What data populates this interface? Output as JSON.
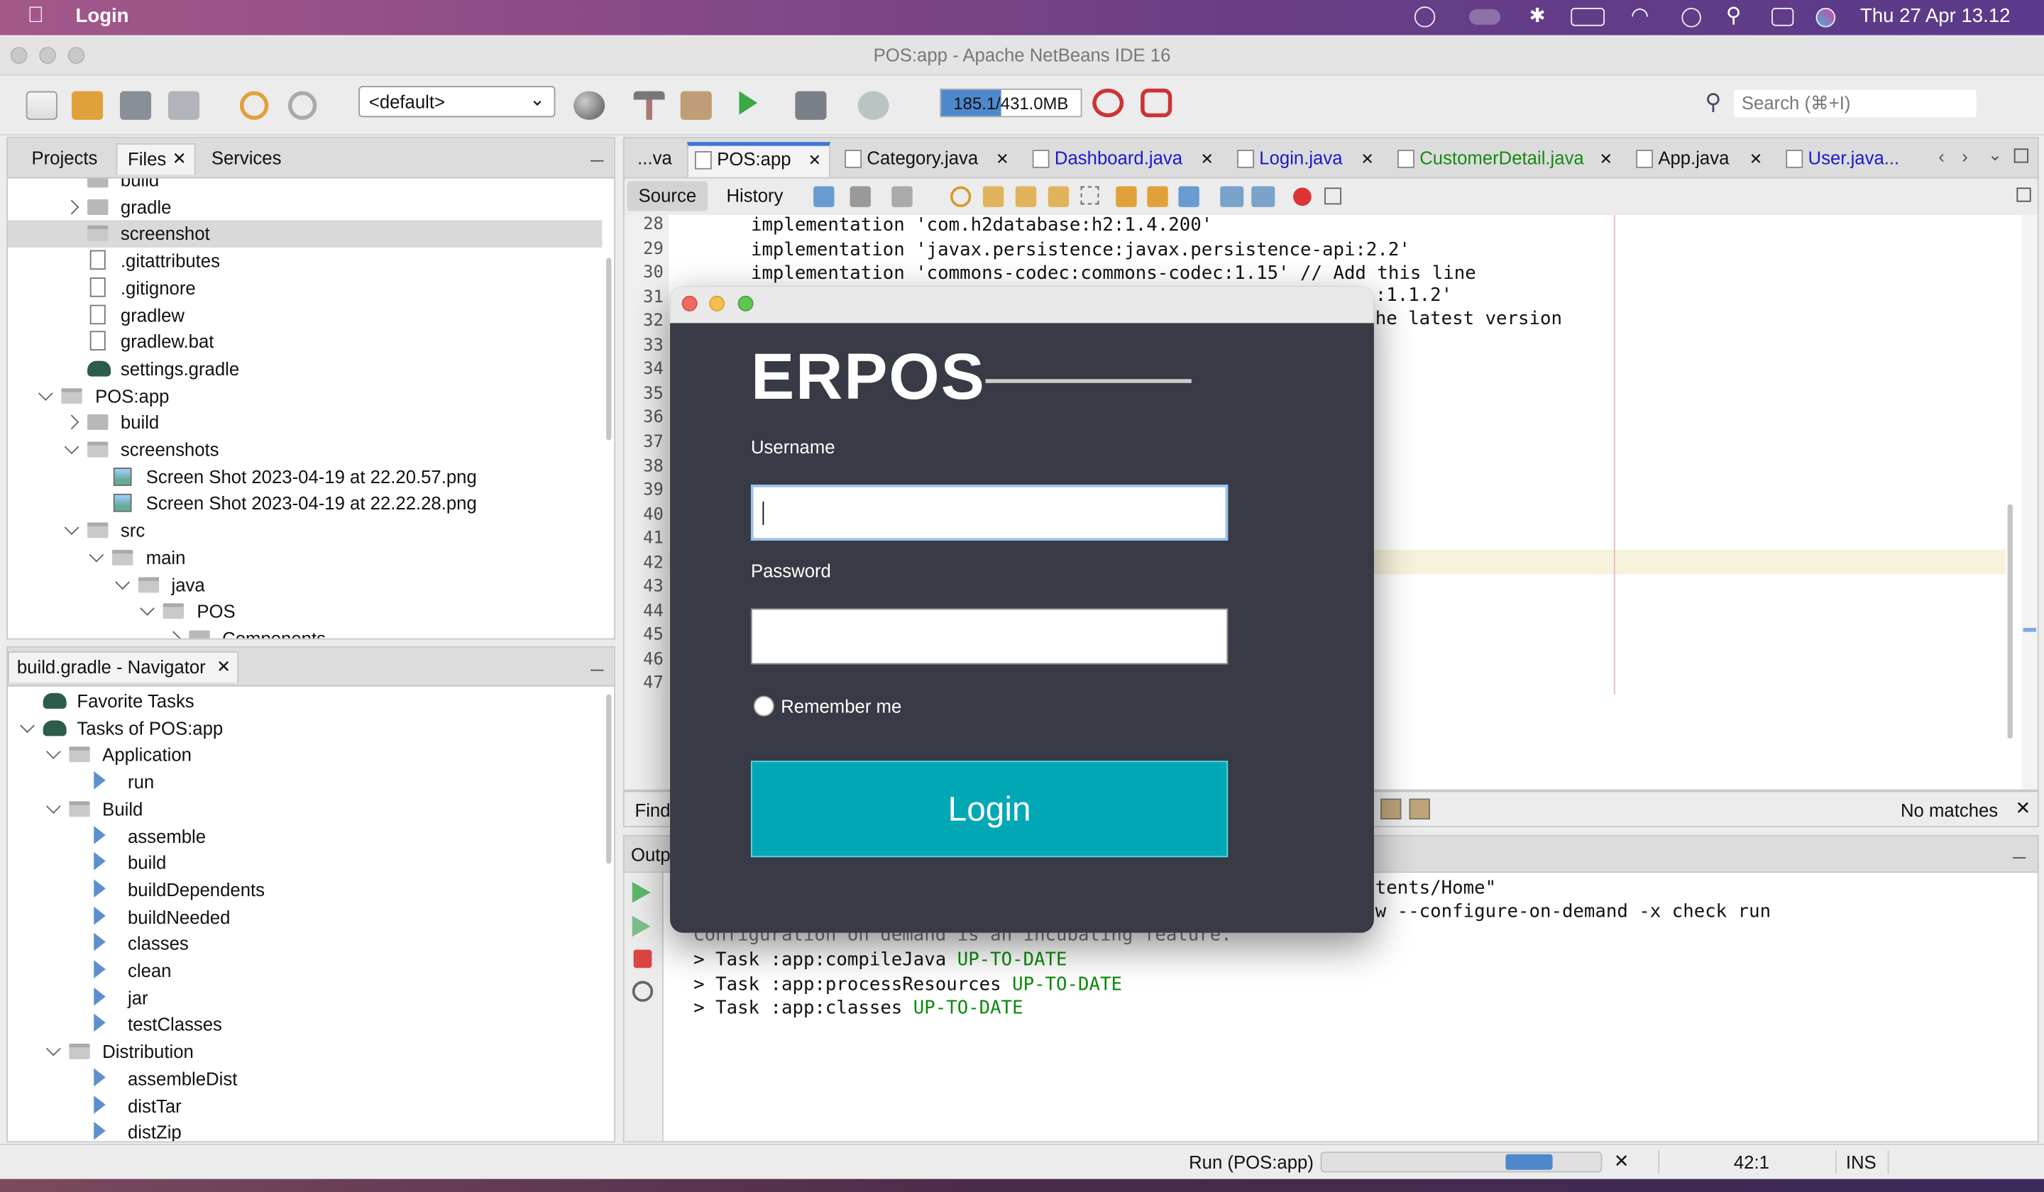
{
  "menubar": {
    "app": "Login",
    "datetime": "Thu 27 Apr  13.12"
  },
  "window": {
    "title": "POS:app - Apache NetBeans IDE 16"
  },
  "toolbar": {
    "config": "<default>",
    "memory": "185.1/431.0MB",
    "memory_fraction": 0.43,
    "search_placeholder": "Search (⌘+I)"
  },
  "left_tabs": [
    "Projects",
    "Files",
    "Services"
  ],
  "files_tree": [
    {
      "label": "build",
      "indent": 1,
      "kind": "folder",
      "arrow": "none"
    },
    {
      "label": "gradle",
      "indent": 1,
      "kind": "folder",
      "arrow": "right"
    },
    {
      "label": "screenshot",
      "indent": 1,
      "kind": "folder-open",
      "arrow": "none",
      "selected": true
    },
    {
      "label": ".gitattributes",
      "indent": 1,
      "kind": "file"
    },
    {
      "label": ".gitignore",
      "indent": 1,
      "kind": "file"
    },
    {
      "label": "gradlew",
      "indent": 1,
      "kind": "file"
    },
    {
      "label": "gradlew.bat",
      "indent": 1,
      "kind": "file"
    },
    {
      "label": "settings.gradle",
      "indent": 1,
      "kind": "gradle"
    },
    {
      "label": "POS:app",
      "indent": 0,
      "kind": "folder-open",
      "arrow": "down"
    },
    {
      "label": "build",
      "indent": 1,
      "kind": "folder",
      "arrow": "right"
    },
    {
      "label": "screenshots",
      "indent": 1,
      "kind": "folder-open",
      "arrow": "down"
    },
    {
      "label": "Screen Shot 2023-04-19 at 22.20.57.png",
      "indent": 2,
      "kind": "image"
    },
    {
      "label": "Screen Shot 2023-04-19 at 22.22.28.png",
      "indent": 2,
      "kind": "image"
    },
    {
      "label": "src",
      "indent": 1,
      "kind": "folder-open",
      "arrow": "down"
    },
    {
      "label": "main",
      "indent": 2,
      "kind": "folder-open",
      "arrow": "down"
    },
    {
      "label": "java",
      "indent": 3,
      "kind": "folder-open",
      "arrow": "down"
    },
    {
      "label": "POS",
      "indent": 4,
      "kind": "folder-open",
      "arrow": "down"
    },
    {
      "label": "Components",
      "indent": 5,
      "kind": "folder",
      "arrow": "right"
    }
  ],
  "navigator": {
    "title": "build.gradle - Navigator",
    "items": [
      {
        "label": "Favorite Tasks",
        "indent": 0,
        "kind": "gradle",
        "arrow": "none"
      },
      {
        "label": "Tasks of POS:app",
        "indent": 0,
        "kind": "gradle",
        "arrow": "down"
      },
      {
        "label": "Application",
        "indent": 1,
        "kind": "folder-open",
        "arrow": "down"
      },
      {
        "label": "run",
        "indent": 2,
        "kind": "task"
      },
      {
        "label": "Build",
        "indent": 1,
        "kind": "folder-open",
        "arrow": "down"
      },
      {
        "label": "assemble",
        "indent": 2,
        "kind": "task"
      },
      {
        "label": "build",
        "indent": 2,
        "kind": "task"
      },
      {
        "label": "buildDependents",
        "indent": 2,
        "kind": "task"
      },
      {
        "label": "buildNeeded",
        "indent": 2,
        "kind": "task"
      },
      {
        "label": "classes",
        "indent": 2,
        "kind": "task"
      },
      {
        "label": "clean",
        "indent": 2,
        "kind": "task"
      },
      {
        "label": "jar",
        "indent": 2,
        "kind": "task"
      },
      {
        "label": "testClasses",
        "indent": 2,
        "kind": "task"
      },
      {
        "label": "Distribution",
        "indent": 1,
        "kind": "folder-open",
        "arrow": "down"
      },
      {
        "label": "assembleDist",
        "indent": 2,
        "kind": "task"
      },
      {
        "label": "distTar",
        "indent": 2,
        "kind": "task"
      },
      {
        "label": "distZip",
        "indent": 2,
        "kind": "task"
      }
    ]
  },
  "editor_tabs": [
    {
      "label": "...va",
      "color": "#111111"
    },
    {
      "label": "POS:app",
      "color": "#111111",
      "active": true
    },
    {
      "label": "Category.java",
      "color": "#111111"
    },
    {
      "label": "Dashboard.java",
      "color": "#1a1ad0"
    },
    {
      "label": "Login.java",
      "color": "#1a1ad0"
    },
    {
      "label": "CustomerDetail.java",
      "color": "#138a13"
    },
    {
      "label": "App.java",
      "color": "#111111"
    },
    {
      "label": "User.java...",
      "color": "#1a1ad0"
    }
  ],
  "editor_subtabs": {
    "source": "Source",
    "history": "History"
  },
  "code": {
    "line_numbers": [
      "28",
      "29",
      "30",
      "31",
      "32",
      "33",
      "34",
      "35",
      "36",
      "37",
      "38",
      "39",
      "40",
      "41",
      "42",
      "43",
      "44",
      "45",
      "46",
      "47"
    ],
    "lines": [
      "    implementation 'com.h2database:h2:1.4.200'",
      "    implementation 'javax.persistence:javax.persistence-api:2.2'",
      "    implementation 'commons-codec:commons-codec:1.15' // Add this line"
    ],
    "partial_31": ":1.1.2'",
    "partial_32": "he latest version"
  },
  "login_dialog": {
    "brand": "ERPOS",
    "username_label": "Username",
    "username_value": "",
    "password_label": "Password",
    "remember": "Remember me",
    "login_button": "Login"
  },
  "find": {
    "label": "Find",
    "no_matches": "No matches"
  },
  "output": {
    "label": "Outp",
    "partial_1": "tents/Home\"",
    "partial_2": "w --configure-on-demand -x check run",
    "partial_3": "Configuration on demand is an incubating feature.",
    "tasks": [
      {
        "task": "> Task :app:compileJava ",
        "status": "UP-TO-DATE"
      },
      {
        "task": "> Task :app:processResources ",
        "status": "UP-TO-DATE"
      },
      {
        "task": "> Task :app:classes ",
        "status": "UP-TO-DATE"
      }
    ]
  },
  "status": {
    "run": "Run (POS:app)",
    "position": "42:1",
    "mode": "INS",
    "progress_fraction": 0.2
  }
}
